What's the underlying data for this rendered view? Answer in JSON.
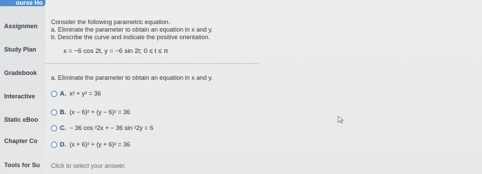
{
  "sidebar": {
    "top_tab": "ourse Ho",
    "items": [
      {
        "label": "Assignmen"
      },
      {
        "label": "Study Plan"
      },
      {
        "label": "Gradebook"
      },
      {
        "label": "Interactive"
      },
      {
        "label": "Static eBoo"
      },
      {
        "label": "Chapter Co"
      },
      {
        "label": "Tools for Su"
      }
    ]
  },
  "question": {
    "intro": "Consider the following parametric equation.",
    "part_a_instruction": "a. Eliminate the parameter to obtain an equation in x and y.",
    "part_b_instruction": "b. Describe the curve and indicate the positive orientation.",
    "equation": {
      "x_part": "x = −6 cos 2t, y = −6 sin 2t;",
      "range": "0 ≤ t ≤ π"
    },
    "part_a_title": "a. Eliminate the parameter to obtain an equation in x and y.",
    "options": [
      {
        "letter": "A.",
        "text": "x² + y² = 36"
      },
      {
        "letter": "B.",
        "text": "(x − 6)² + (y − 6)² = 36"
      },
      {
        "letter": "C.",
        "text": "− 36 cos ²2x + − 36 sin ²2y = 6"
      },
      {
        "letter": "D.",
        "text": "(x + 6)² + (y + 6)² = 36"
      }
    ],
    "hint": "Click to select your answer."
  }
}
